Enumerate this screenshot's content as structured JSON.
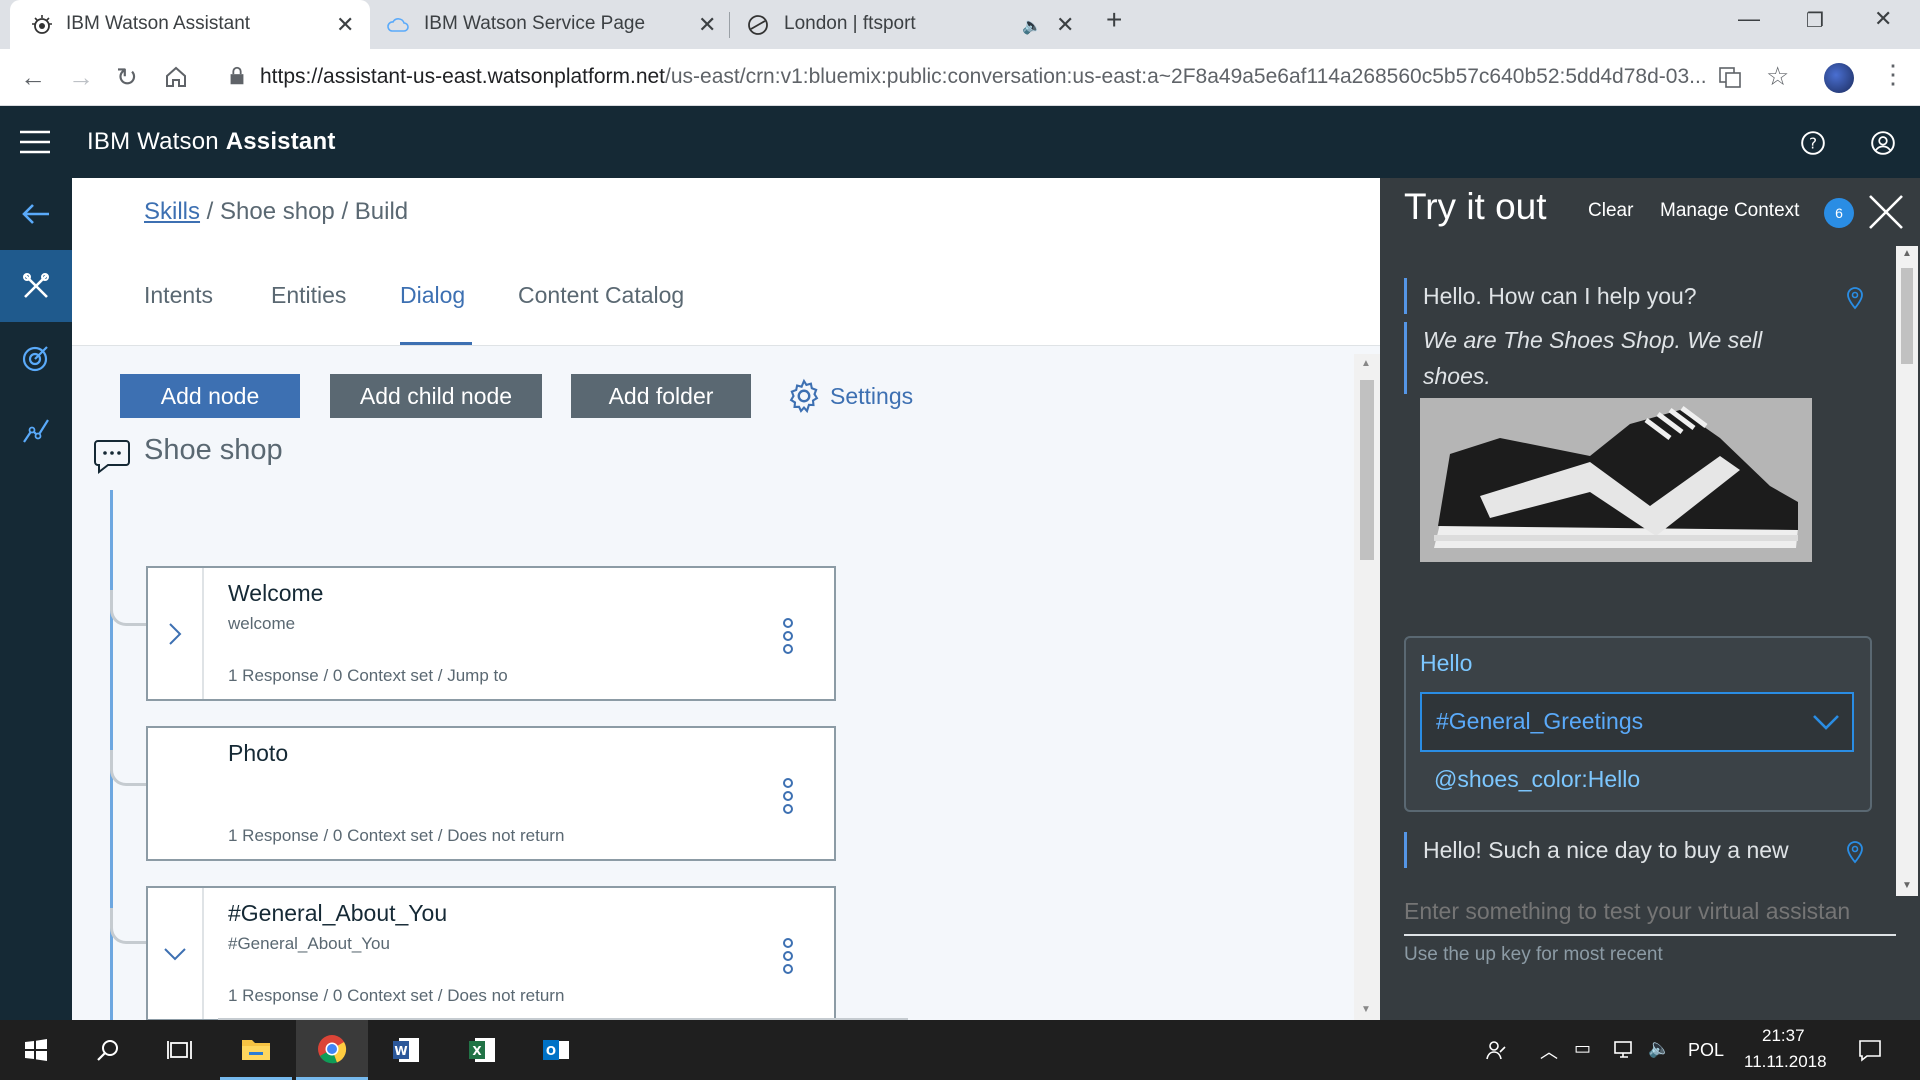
{
  "browser": {
    "tabs": [
      {
        "title": "IBM Watson Assistant",
        "active": true
      },
      {
        "title": "IBM Watson Service Page",
        "active": false
      },
      {
        "title": "London | ftsport",
        "active": false
      }
    ],
    "url_host": "https://assistant-us-east.watsonplatform.net",
    "url_rest": "/us-east/crn:v1:bluemix:public:conversation:us-east:a~2F8a49a5e6af114a268560c5b57c640b52:5dd4d78d-03..."
  },
  "header": {
    "title_light": "IBM Watson ",
    "title_bold": "Assistant"
  },
  "breadcrumb": {
    "link": "Skills",
    "rest": " / Shoe shop / Build"
  },
  "tabs": [
    "Intents",
    "Entities",
    "Dialog",
    "Content Catalog"
  ],
  "toolbar": {
    "add_node": "Add node",
    "add_child_node": "Add child node",
    "add_folder": "Add folder",
    "settings": "Settings"
  },
  "dialog": {
    "root_title": "Shoe shop",
    "nodes": [
      {
        "title": "Welcome",
        "condition": "welcome",
        "meta": "1 Response / 0 Context set / Jump to"
      },
      {
        "title": "Photo",
        "condition": "",
        "meta": "1 Response / 0 Context set / Does not return"
      },
      {
        "title": "#General_About_You",
        "condition": "#General_About_You",
        "meta": "1 Response / 0 Context set / Does not return"
      }
    ]
  },
  "try_panel": {
    "title": "Try it out",
    "clear": "Clear",
    "manage_context": "Manage Context",
    "context_count": "6",
    "bot_greeting": "Hello. How can I help you?",
    "bot_line2a": "We are The Shoes Shop. We sell",
    "bot_line2b": "shoes.",
    "user_message": "Hello",
    "intent": "#General_Greetings",
    "entity": "@shoes_color:Hello",
    "bot_reply": "Hello! Such a nice day to buy a new",
    "input_placeholder": "Enter something to test your virtual assistan",
    "hint": "Use the up key for most recent"
  },
  "taskbar": {
    "language": "POL",
    "time": "21:37",
    "date": "11.11.2018"
  }
}
